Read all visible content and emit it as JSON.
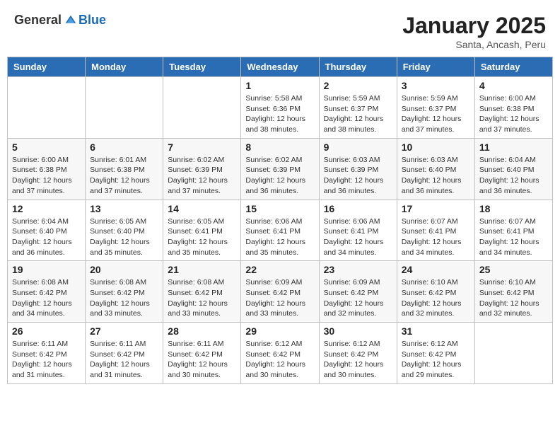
{
  "logo": {
    "text_general": "General",
    "text_blue": "Blue"
  },
  "header": {
    "month": "January 2025",
    "location": "Santa, Ancash, Peru"
  },
  "weekdays": [
    "Sunday",
    "Monday",
    "Tuesday",
    "Wednesday",
    "Thursday",
    "Friday",
    "Saturday"
  ],
  "weeks": [
    [
      {
        "day": "",
        "detail": ""
      },
      {
        "day": "",
        "detail": ""
      },
      {
        "day": "",
        "detail": ""
      },
      {
        "day": "1",
        "detail": "Sunrise: 5:58 AM\nSunset: 6:36 PM\nDaylight: 12 hours and 38 minutes."
      },
      {
        "day": "2",
        "detail": "Sunrise: 5:59 AM\nSunset: 6:37 PM\nDaylight: 12 hours and 38 minutes."
      },
      {
        "day": "3",
        "detail": "Sunrise: 5:59 AM\nSunset: 6:37 PM\nDaylight: 12 hours and 37 minutes."
      },
      {
        "day": "4",
        "detail": "Sunrise: 6:00 AM\nSunset: 6:38 PM\nDaylight: 12 hours and 37 minutes."
      }
    ],
    [
      {
        "day": "5",
        "detail": "Sunrise: 6:00 AM\nSunset: 6:38 PM\nDaylight: 12 hours and 37 minutes."
      },
      {
        "day": "6",
        "detail": "Sunrise: 6:01 AM\nSunset: 6:38 PM\nDaylight: 12 hours and 37 minutes."
      },
      {
        "day": "7",
        "detail": "Sunrise: 6:02 AM\nSunset: 6:39 PM\nDaylight: 12 hours and 37 minutes."
      },
      {
        "day": "8",
        "detail": "Sunrise: 6:02 AM\nSunset: 6:39 PM\nDaylight: 12 hours and 36 minutes."
      },
      {
        "day": "9",
        "detail": "Sunrise: 6:03 AM\nSunset: 6:39 PM\nDaylight: 12 hours and 36 minutes."
      },
      {
        "day": "10",
        "detail": "Sunrise: 6:03 AM\nSunset: 6:40 PM\nDaylight: 12 hours and 36 minutes."
      },
      {
        "day": "11",
        "detail": "Sunrise: 6:04 AM\nSunset: 6:40 PM\nDaylight: 12 hours and 36 minutes."
      }
    ],
    [
      {
        "day": "12",
        "detail": "Sunrise: 6:04 AM\nSunset: 6:40 PM\nDaylight: 12 hours and 36 minutes."
      },
      {
        "day": "13",
        "detail": "Sunrise: 6:05 AM\nSunset: 6:40 PM\nDaylight: 12 hours and 35 minutes."
      },
      {
        "day": "14",
        "detail": "Sunrise: 6:05 AM\nSunset: 6:41 PM\nDaylight: 12 hours and 35 minutes."
      },
      {
        "day": "15",
        "detail": "Sunrise: 6:06 AM\nSunset: 6:41 PM\nDaylight: 12 hours and 35 minutes."
      },
      {
        "day": "16",
        "detail": "Sunrise: 6:06 AM\nSunset: 6:41 PM\nDaylight: 12 hours and 34 minutes."
      },
      {
        "day": "17",
        "detail": "Sunrise: 6:07 AM\nSunset: 6:41 PM\nDaylight: 12 hours and 34 minutes."
      },
      {
        "day": "18",
        "detail": "Sunrise: 6:07 AM\nSunset: 6:41 PM\nDaylight: 12 hours and 34 minutes."
      }
    ],
    [
      {
        "day": "19",
        "detail": "Sunrise: 6:08 AM\nSunset: 6:42 PM\nDaylight: 12 hours and 34 minutes."
      },
      {
        "day": "20",
        "detail": "Sunrise: 6:08 AM\nSunset: 6:42 PM\nDaylight: 12 hours and 33 minutes."
      },
      {
        "day": "21",
        "detail": "Sunrise: 6:08 AM\nSunset: 6:42 PM\nDaylight: 12 hours and 33 minutes."
      },
      {
        "day": "22",
        "detail": "Sunrise: 6:09 AM\nSunset: 6:42 PM\nDaylight: 12 hours and 33 minutes."
      },
      {
        "day": "23",
        "detail": "Sunrise: 6:09 AM\nSunset: 6:42 PM\nDaylight: 12 hours and 32 minutes."
      },
      {
        "day": "24",
        "detail": "Sunrise: 6:10 AM\nSunset: 6:42 PM\nDaylight: 12 hours and 32 minutes."
      },
      {
        "day": "25",
        "detail": "Sunrise: 6:10 AM\nSunset: 6:42 PM\nDaylight: 12 hours and 32 minutes."
      }
    ],
    [
      {
        "day": "26",
        "detail": "Sunrise: 6:11 AM\nSunset: 6:42 PM\nDaylight: 12 hours and 31 minutes."
      },
      {
        "day": "27",
        "detail": "Sunrise: 6:11 AM\nSunset: 6:42 PM\nDaylight: 12 hours and 31 minutes."
      },
      {
        "day": "28",
        "detail": "Sunrise: 6:11 AM\nSunset: 6:42 PM\nDaylight: 12 hours and 30 minutes."
      },
      {
        "day": "29",
        "detail": "Sunrise: 6:12 AM\nSunset: 6:42 PM\nDaylight: 12 hours and 30 minutes."
      },
      {
        "day": "30",
        "detail": "Sunrise: 6:12 AM\nSunset: 6:42 PM\nDaylight: 12 hours and 30 minutes."
      },
      {
        "day": "31",
        "detail": "Sunrise: 6:12 AM\nSunset: 6:42 PM\nDaylight: 12 hours and 29 minutes."
      },
      {
        "day": "",
        "detail": ""
      }
    ]
  ]
}
